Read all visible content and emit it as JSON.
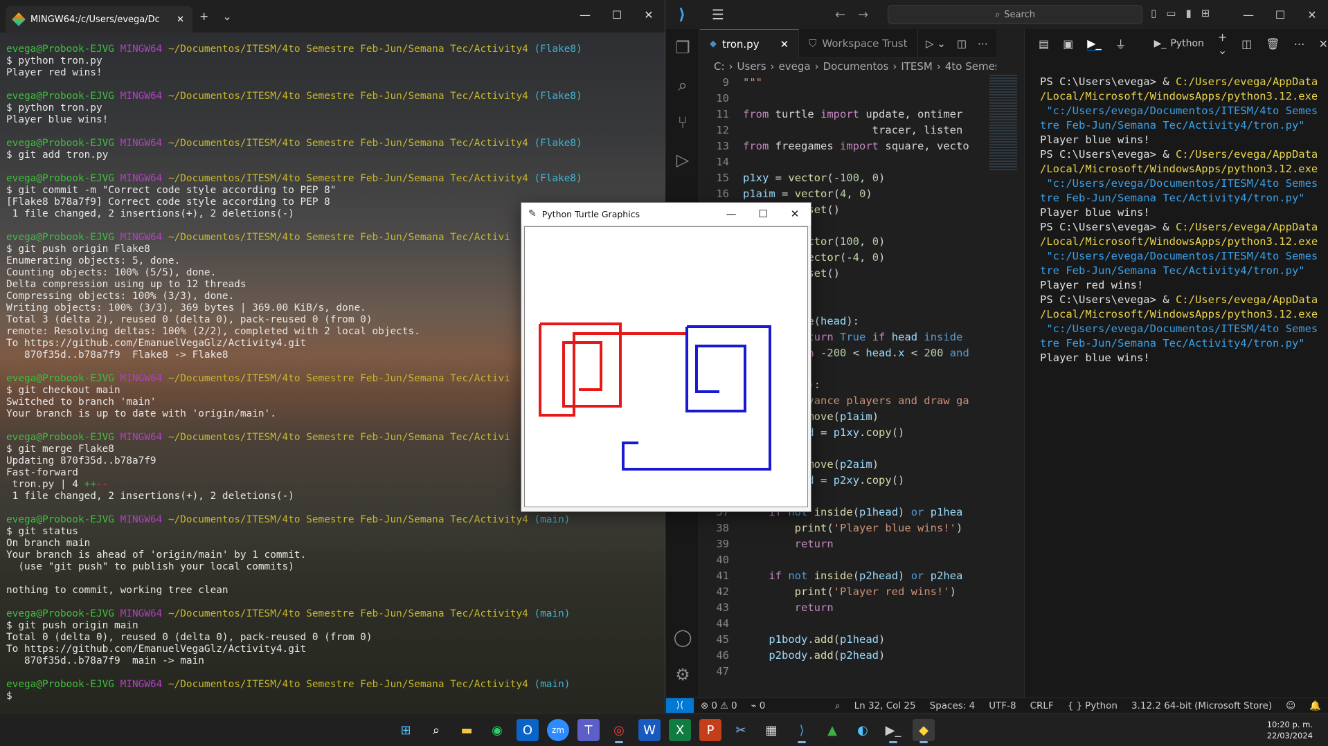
{
  "terminal": {
    "tab_title": "MINGW64:/c/Users/evega/Dc",
    "prompt": {
      "user": "evega@Probook-EJVG",
      "host": "MINGW64",
      "path": "~/Documentos/ITESM/4to Semestre Feb-Jun/Semana Tec/Activity4",
      "path_short": "~/Documentos/ITESM/4to Semestre Feb-Jun/Semana Tec/Activi"
    },
    "lines": [
      {
        "type": "prompt",
        "branch": "(Flake8)"
      },
      {
        "type": "out",
        "text": "$ python tron.py"
      },
      {
        "type": "out",
        "text": "Player red wins!"
      },
      {
        "type": "blank"
      },
      {
        "type": "prompt",
        "branch": "(Flake8)"
      },
      {
        "type": "out",
        "text": "$ python tron.py"
      },
      {
        "type": "out",
        "text": "Player blue wins!"
      },
      {
        "type": "blank"
      },
      {
        "type": "prompt",
        "branch": "(Flake8)"
      },
      {
        "type": "out",
        "text": "$ git add tron.py"
      },
      {
        "type": "blank"
      },
      {
        "type": "prompt",
        "branch": "(Flake8)"
      },
      {
        "type": "out",
        "text": "$ git commit -m \"Correct code style according to PEP 8\""
      },
      {
        "type": "out",
        "text": "[Flake8 b78a7f9] Correct code style according to PEP 8"
      },
      {
        "type": "out",
        "text": " 1 file changed, 2 insertions(+), 2 deletions(-)"
      },
      {
        "type": "blank"
      },
      {
        "type": "prompt_short",
        "branch": ""
      },
      {
        "type": "out",
        "text": "$ git push origin Flake8"
      },
      {
        "type": "out",
        "text": "Enumerating objects: 5, done."
      },
      {
        "type": "out",
        "text": "Counting objects: 100% (5/5), done."
      },
      {
        "type": "out",
        "text": "Delta compression using up to 12 threads"
      },
      {
        "type": "out",
        "text": "Compressing objects: 100% (3/3), done."
      },
      {
        "type": "out",
        "text": "Writing objects: 100% (3/3), 369 bytes | 369.00 KiB/s, done."
      },
      {
        "type": "out",
        "text": "Total 3 (delta 2), reused 0 (delta 0), pack-reused 0 (from 0)"
      },
      {
        "type": "out",
        "text": "remote: Resolving deltas: 100% (2/2), completed with 2 local objects."
      },
      {
        "type": "out",
        "text": "To https://github.com/EmanuelVegaGlz/Activity4.git"
      },
      {
        "type": "out",
        "text": "   870f35d..b78a7f9  Flake8 -> Flake8"
      },
      {
        "type": "blank"
      },
      {
        "type": "prompt_short",
        "branch": ""
      },
      {
        "type": "out",
        "text": "$ git checkout main"
      },
      {
        "type": "out",
        "text": "Switched to branch 'main'"
      },
      {
        "type": "out",
        "text": "Your branch is up to date with 'origin/main'."
      },
      {
        "type": "blank"
      },
      {
        "type": "prompt_short",
        "branch": ""
      },
      {
        "type": "out",
        "text": "$ git merge Flake8"
      },
      {
        "type": "out",
        "text": "Updating 870f35d..b78a7f9"
      },
      {
        "type": "out",
        "text": "Fast-forward"
      },
      {
        "type": "diffstat",
        "text": " tron.py | 4 ",
        "plus": "++",
        "minus": "--"
      },
      {
        "type": "out",
        "text": " 1 file changed, 2 insertions(+), 2 deletions(-)"
      },
      {
        "type": "blank"
      },
      {
        "type": "prompt",
        "branch": "(main)"
      },
      {
        "type": "out",
        "text": "$ git status"
      },
      {
        "type": "out",
        "text": "On branch main"
      },
      {
        "type": "out",
        "text": "Your branch is ahead of 'origin/main' by 1 commit."
      },
      {
        "type": "out",
        "text": "  (use \"git push\" to publish your local commits)"
      },
      {
        "type": "blank"
      },
      {
        "type": "out",
        "text": "nothing to commit, working tree clean"
      },
      {
        "type": "blank"
      },
      {
        "type": "prompt",
        "branch": "(main)"
      },
      {
        "type": "out",
        "text": "$ git push origin main"
      },
      {
        "type": "out",
        "text": "Total 0 (delta 0), reused 0 (delta 0), pack-reused 0 (from 0)"
      },
      {
        "type": "out",
        "text": "To https://github.com/EmanuelVegaGlz/Activity4.git"
      },
      {
        "type": "out",
        "text": "   870f35d..b78a7f9  main -> main"
      },
      {
        "type": "blank"
      },
      {
        "type": "prompt",
        "branch": "(main)"
      },
      {
        "type": "out",
        "text": "$"
      }
    ]
  },
  "vscode": {
    "search_placeholder": "Search",
    "tabs": [
      {
        "label": "tron.py",
        "active": true
      },
      {
        "label": "Workspace Trust",
        "active": false
      }
    ],
    "breadcrumb": [
      "C:",
      "Users",
      "evega",
      "Documentos",
      "ITESM",
      "4to Semestre Feb"
    ],
    "code": [
      {
        "n": "9",
        "html": "<span class='str'>\"\"\"</span>"
      },
      {
        "n": "10",
        "html": ""
      },
      {
        "n": "11",
        "html": "<span class='kw'>from</span> <span class='plain'>turtle</span> <span class='kw'>import</span> <span class='plain'>update, ontimer</span>"
      },
      {
        "n": "12",
        "html": "                    <span class='plain'>tracer, listen</span>"
      },
      {
        "n": "13",
        "html": "<span class='kw'>from</span> <span class='plain'>freegames</span> <span class='kw'>import</span> <span class='plain'>square, vecto</span>"
      },
      {
        "n": "14",
        "html": ""
      },
      {
        "n": "15",
        "html": "<span class='var'>p1xy</span> <span class='plain'>=</span> <span class='fn'>vector</span><span class='plain'>(-</span><span class='num'>100</span><span class='plain'>, </span><span class='num'>0</span><span class='plain'>)</span>"
      },
      {
        "n": "16",
        "html": "<span class='var'>p1aim</span> <span class='plain'>=</span> <span class='fn'>vector</span><span class='plain'>(</span><span class='num'>4</span><span class='plain'>, </span><span class='num'>0</span><span class='plain'>)</span>"
      },
      {
        "n": "17",
        "html": "          <span class='fn'>set</span><span class='plain'>()</span>"
      },
      {
        "n": "18",
        "html": ""
      },
      {
        "n": "19",
        "html": "         <span class='fn'>ector</span><span class='plain'>(</span><span class='num'>100</span><span class='plain'>, </span><span class='num'>0</span><span class='plain'>)</span>"
      },
      {
        "n": "20",
        "html": "         <span class='fn'>vector</span><span class='plain'>(-</span><span class='num'>4</span><span class='plain'>, </span><span class='num'>0</span><span class='plain'>)</span>"
      },
      {
        "n": "21",
        "html": "          <span class='fn'>set</span><span class='plain'>()</span>"
      },
      {
        "n": "22",
        "html": ""
      },
      {
        "n": "23",
        "html": ""
      },
      {
        "n": "24",
        "html": "         <span class='fn'>de</span><span class='plain'>(</span><span class='var'>head</span><span class='plain'>):</span>"
      },
      {
        "n": "25",
        "html": "         <span class='kw'>eturn</span> <span class='kw2'>True</span> <span class='kw'>if</span> <span class='var'>head</span> <span class='kw2'>inside</span>"
      },
      {
        "n": "26",
        "html": "         <span class='kw'>rn</span> <span class='plain'>-</span><span class='num'>200</span> <span class='plain'>&lt;</span> <span class='var'>head</span><span class='plain'>.</span><span class='var'>x</span> <span class='plain'>&lt;</span> <span class='num'>200</span> <span class='kw2'>and</span>"
      },
      {
        "n": "27",
        "html": ""
      },
      {
        "n": "28",
        "html": "         <span class='plain'>():</span>"
      },
      {
        "n": "29",
        "html": "         <span class='str'>dvance players and draw ga</span>"
      },
      {
        "n": "30",
        "html": "         <span class='plain'>.</span><span class='fn'>move</span><span class='plain'>(</span><span class='var'>p1aim</span><span class='plain'>)</span>"
      },
      {
        "n": "31",
        "html": "         <span class='var'>ad</span> <span class='plain'>=</span> <span class='var'>p1xy</span><span class='plain'>.</span><span class='fn'>copy</span><span class='plain'>()</span>"
      },
      {
        "n": "32",
        "html": ""
      },
      {
        "n": "33",
        "html": "         <span class='plain'>.</span><span class='fn'>move</span><span class='plain'>(</span><span class='var'>p2aim</span><span class='plain'>)</span>"
      },
      {
        "n": "34",
        "html": "         <span class='var'>ad</span> <span class='plain'>=</span> <span class='var'>p2xy</span><span class='plain'>.</span><span class='fn'>copy</span><span class='plain'>()</span>"
      },
      {
        "n": "35",
        "html": ""
      },
      {
        "n": "37",
        "html": "    <span class='kw'>if</span> <span class='kw2'>not</span> <span class='fn'>inside</span><span class='plain'>(</span><span class='var'>p1head</span><span class='plain'>)</span> <span class='kw2'>or</span> <span class='var'>p1hea</span>"
      },
      {
        "n": "38",
        "html": "        <span class='fn'>print</span><span class='plain'>(</span><span class='str'>'Player blue wins!'</span><span class='plain'>)</span>"
      },
      {
        "n": "39",
        "html": "        <span class='kw'>return</span>"
      },
      {
        "n": "40",
        "html": ""
      },
      {
        "n": "41",
        "html": "    <span class='kw'>if</span> <span class='kw2'>not</span> <span class='fn'>inside</span><span class='plain'>(</span><span class='var'>p2head</span><span class='plain'>)</span> <span class='kw2'>or</span> <span class='var'>p2hea</span>"
      },
      {
        "n": "42",
        "html": "        <span class='fn'>print</span><span class='plain'>(</span><span class='str'>'Player red wins!'</span><span class='plain'>)</span>"
      },
      {
        "n": "43",
        "html": "        <span class='kw'>return</span>"
      },
      {
        "n": "44",
        "html": ""
      },
      {
        "n": "45",
        "html": "    <span class='var'>p1body</span><span class='plain'>.</span><span class='fn'>add</span><span class='plain'>(</span><span class='var'>p1head</span><span class='plain'>)</span>"
      },
      {
        "n": "46",
        "html": "    <span class='var'>p2body</span><span class='plain'>.</span><span class='fn'>add</span><span class='plain'>(</span><span class='var'>p2head</span><span class='plain'>)</span>"
      },
      {
        "n": "47",
        "html": ""
      }
    ],
    "terminal_kind": "Python",
    "ps_runs": [
      {
        "prompt": "PS C:\\Users\\evega> & ",
        "exe1": "C:/Users/evega/AppData",
        "exe2": "/Local/Microsoft/WindowsApps/python3.12.exe",
        "arg1": " \"c:/Users/evega/Documentos/ITESM/4to Semes",
        "arg2": "tre Feb-Jun/Semana Tec/Activity4/tron.py\"",
        "result": "Player blue wins!"
      },
      {
        "prompt": "PS C:\\Users\\evega> & ",
        "exe1": "C:/Users/evega/AppData",
        "exe2": "/Local/Microsoft/WindowsApps/python3.12.exe",
        "arg1": " \"c:/Users/evega/Documentos/ITESM/4to Semes",
        "arg2": "tre Feb-Jun/Semana Tec/Activity4/tron.py\"",
        "result": "Player blue wins!"
      },
      {
        "prompt": "PS C:\\Users\\evega> & ",
        "exe1": "C:/Users/evega/AppData",
        "exe2": "/Local/Microsoft/WindowsApps/python3.12.exe",
        "arg1": " \"c:/Users/evega/Documentos/ITESM/4to Semes",
        "arg2": "tre Feb-Jun/Semana Tec/Activity4/tron.py\"",
        "result": "Player red wins!"
      },
      {
        "prompt": "PS C:\\Users\\evega> & ",
        "exe1": "C:/Users/evega/AppData",
        "exe2": "/Local/Microsoft/WindowsApps/python3.12.exe",
        "arg1": " \"c:/Users/evega/Documentos/ITESM/4to Semes",
        "arg2": "tre Feb-Jun/Semana Tec/Activity4/tron.py\"",
        "result": "Player blue wins!"
      }
    ],
    "status": {
      "errors": "0",
      "warnings": "0",
      "ports": "0",
      "cursor": "Ln 32, Col 25",
      "spaces": "Spaces: 4",
      "encoding": "UTF-8",
      "eol": "CRLF",
      "language": "Python",
      "interpreter": "3.12.2 64-bit (Microsoft Store)"
    }
  },
  "turtle": {
    "title": "Python Turtle Graphics",
    "colors": {
      "red": "#e61919",
      "blue": "#1919d2"
    },
    "red_path": [
      [
        -182,
        62
      ],
      [
        -66,
        62
      ],
      [
        -66,
        -57
      ],
      [
        -148,
        -57
      ],
      [
        -148,
        35
      ],
      [
        -94,
        35
      ],
      [
        -94,
        -33
      ],
      [
        -126,
        -33
      ]
    ],
    "red_path2": [
      [
        -182,
        62
      ],
      [
        -182,
        -70
      ],
      [
        -133,
        -70
      ],
      [
        -133,
        48
      ],
      [
        30,
        48
      ]
    ],
    "blue_path": [
      [
        30,
        58
      ],
      [
        150,
        58
      ],
      [
        150,
        -148
      ],
      [
        -62,
        -148
      ],
      [
        -62,
        -110
      ],
      [
        -40,
        -110
      ]
    ],
    "blue_path2": [
      [
        30,
        58
      ],
      [
        30,
        -64
      ],
      [
        114,
        -64
      ],
      [
        114,
        30
      ],
      [
        44,
        30
      ],
      [
        44,
        -36
      ],
      [
        77,
        -36
      ]
    ]
  },
  "taskbar": {
    "time": "10:20 p. m.",
    "date": "22/03/2024"
  }
}
